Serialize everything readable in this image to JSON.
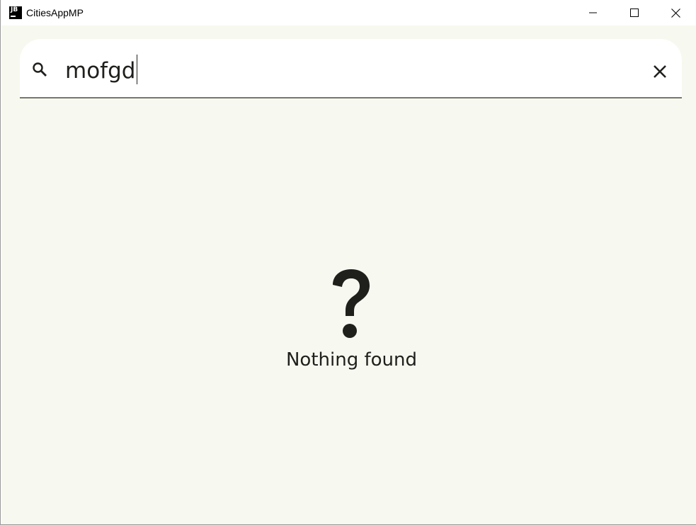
{
  "window": {
    "title": "CitiesAppMP",
    "logo_text": "JB"
  },
  "search": {
    "value": "mofgd",
    "icon": "search-icon",
    "clear_icon": "close-icon"
  },
  "empty_state": {
    "icon": "question-mark-icon",
    "message": "Nothing found"
  },
  "colors": {
    "background": "#f7f8ef",
    "search_surface": "#ffffff",
    "underline": "#75796a",
    "text": "#1f1f1c"
  }
}
